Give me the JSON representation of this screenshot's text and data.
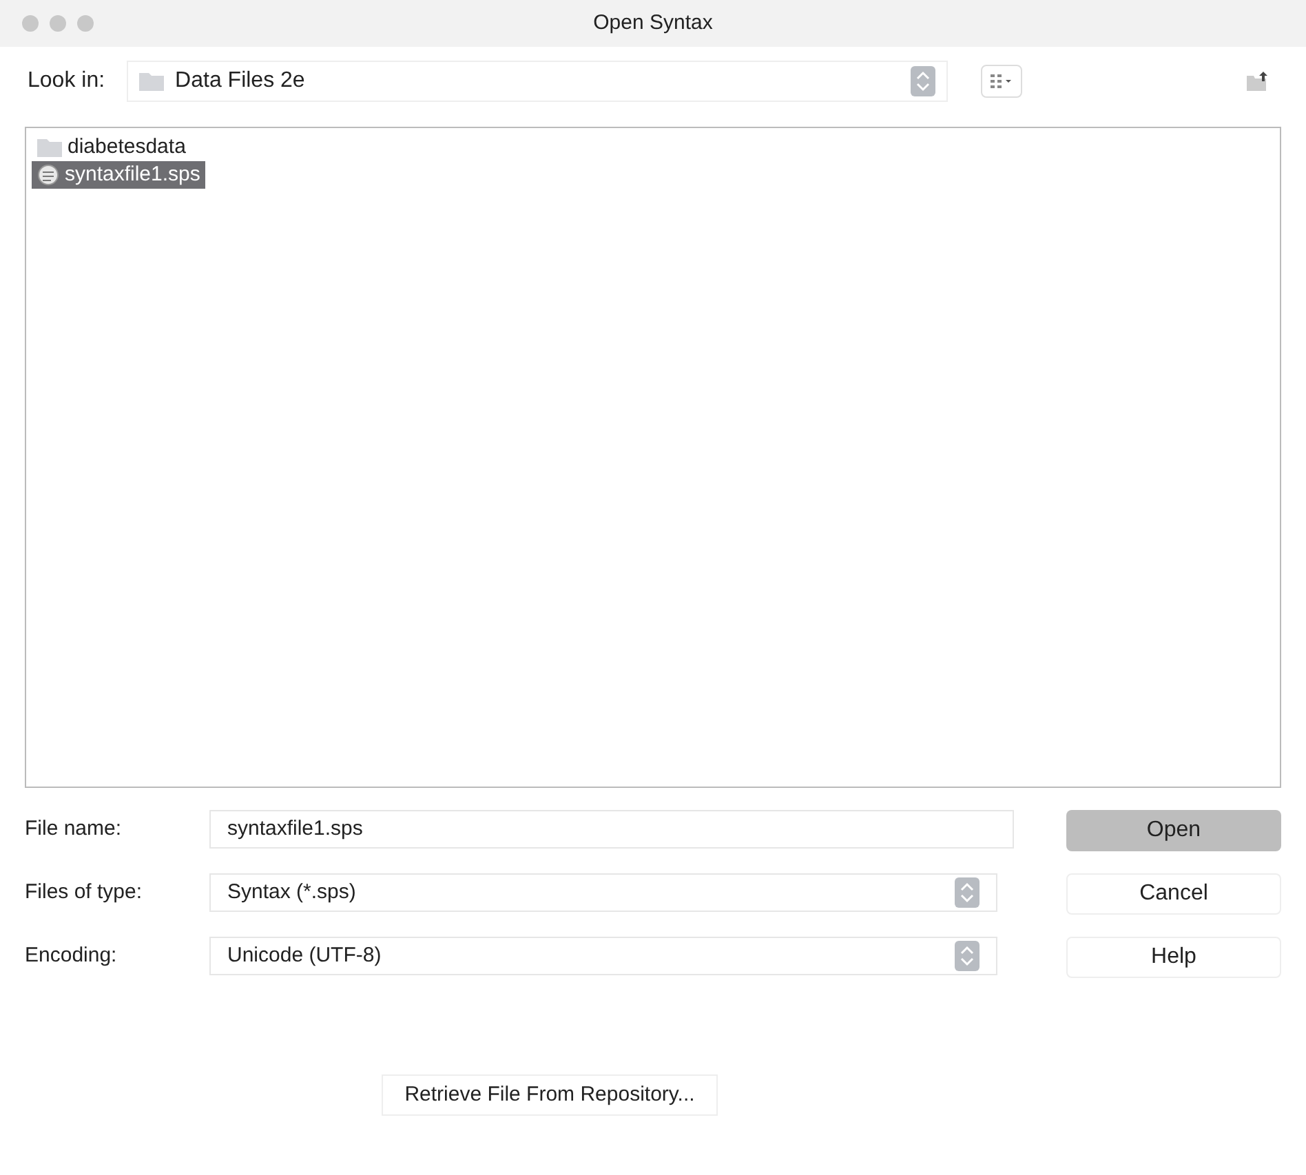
{
  "window": {
    "title": "Open Syntax"
  },
  "look_in": {
    "label": "Look in:",
    "value": "Data Files 2e"
  },
  "files": [
    {
      "name": "diabetesdata",
      "kind": "folder",
      "selected": false
    },
    {
      "name": "syntaxfile1.sps",
      "kind": "syntax",
      "selected": true
    }
  ],
  "file_name": {
    "label": "File name:",
    "value": "syntaxfile1.sps"
  },
  "files_of_type": {
    "label": "Files of type:",
    "value": "Syntax (*.sps)"
  },
  "encoding": {
    "label": "Encoding:",
    "value": "Unicode (UTF-8)"
  },
  "buttons": [
    {
      "label": "Open",
      "kind": "default"
    },
    {
      "label": "Cancel",
      "kind": "normal"
    },
    {
      "label": "Help",
      "kind": "normal"
    }
  ],
  "retrieve_button": "Retrieve File From Repository..."
}
